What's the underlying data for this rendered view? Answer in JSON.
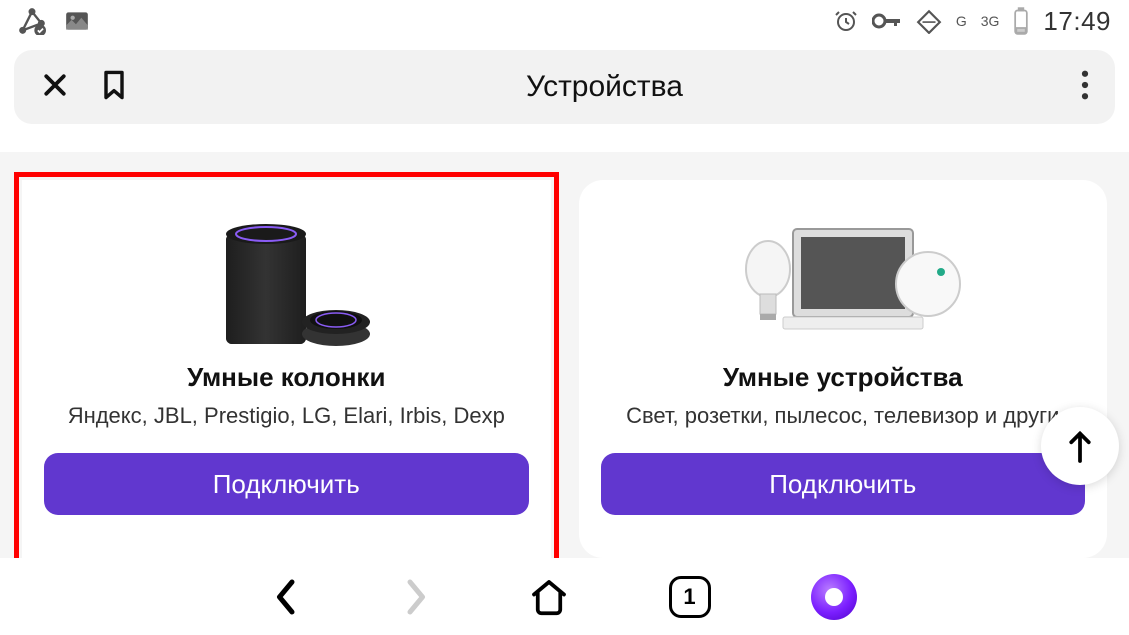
{
  "statusBar": {
    "clock": "17:49",
    "signal1": "G",
    "signal2": "3G"
  },
  "header": {
    "title": "Устройства"
  },
  "cards": [
    {
      "title": "Умные колонки",
      "subtitle": "Яндекс, JBL, Prestigio, LG, Elari, Irbis, Dexp",
      "button": "Подключить",
      "highlighted": true,
      "icon": "speaker"
    },
    {
      "title": "Умные устройства",
      "subtitle": "Свет, розетки, пылесос, телевизор и други",
      "button": "Подключить",
      "highlighted": false,
      "icon": "devices"
    }
  ],
  "bottomNav": {
    "tabCount": "1"
  },
  "colors": {
    "primary": "#6137cf",
    "highlight": "#ff0000"
  }
}
